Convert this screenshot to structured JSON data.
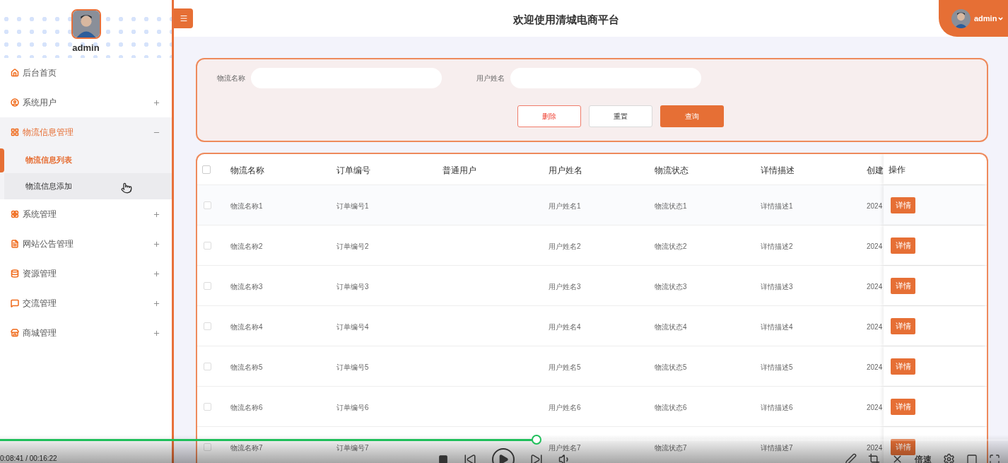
{
  "sidebar": {
    "user": {
      "name": "admin"
    },
    "menu": [
      {
        "label": "后台首页"
      },
      {
        "label": "系统用户",
        "expanded": false
      },
      {
        "label": "物流信息管理",
        "expanded": true,
        "children": [
          {
            "label": "物流信息列表",
            "selected": true,
            "hovered": false
          },
          {
            "label": "物流信息添加",
            "selected": false,
            "hovered": true
          }
        ]
      },
      {
        "label": "系统管理",
        "expanded": false
      },
      {
        "label": "网站公告管理",
        "expanded": false
      },
      {
        "label": "资源管理",
        "expanded": false
      },
      {
        "label": "交流管理",
        "expanded": false
      },
      {
        "label": "商城管理",
        "expanded": false
      }
    ]
  },
  "header": {
    "title": "欢迎使用清城电商平台",
    "user": "admin"
  },
  "search": {
    "fields": [
      {
        "label": "物流名称"
      },
      {
        "label": "用户姓名"
      }
    ],
    "buttons": [
      {
        "label": "删除",
        "kind": "danger"
      },
      {
        "label": "重置",
        "kind": "plain"
      },
      {
        "label": "查询",
        "kind": "primary"
      }
    ]
  },
  "table": {
    "all_selected": false,
    "columns": [
      "物流名称",
      "订单编号",
      "普通用户",
      "用户姓名",
      "物流状态",
      "详情描述",
      "创建",
      "操作"
    ],
    "rows": [
      {
        "selected": false,
        "cells": [
          "物流名称1",
          "订单编号1",
          "",
          "用户姓名1",
          "物流状态1",
          "详情描述1",
          "2024"
        ],
        "action": "详情"
      },
      {
        "selected": false,
        "cells": [
          "物流名称2",
          "订单编号2",
          "",
          "用户姓名2",
          "物流状态2",
          "详情描述2",
          "2024"
        ],
        "action": "详情"
      },
      {
        "selected": false,
        "cells": [
          "物流名称3",
          "订单编号3",
          "",
          "用户姓名3",
          "物流状态3",
          "详情描述3",
          "2024"
        ],
        "action": "详情"
      },
      {
        "selected": false,
        "cells": [
          "物流名称4",
          "订单编号4",
          "",
          "用户姓名4",
          "物流状态4",
          "详情描述4",
          "2024"
        ],
        "action": "详情"
      },
      {
        "selected": false,
        "cells": [
          "物流名称5",
          "订单编号5",
          "",
          "用户姓名5",
          "物流状态5",
          "详情描述5",
          "2024"
        ],
        "action": "详情"
      },
      {
        "selected": false,
        "cells": [
          "物流名称6",
          "订单编号6",
          "",
          "用户姓名6",
          "物流状态6",
          "详情描述6",
          "2024"
        ],
        "action": "详情"
      },
      {
        "selected": false,
        "cells": [
          "物流名称7",
          "订单编号7",
          "",
          "用户姓名7",
          "物流状态7",
          "详情描述7",
          "2024"
        ],
        "action": "详情"
      }
    ]
  },
  "player": {
    "time": "0:08:41 / 00:16:22",
    "level": 0.532,
    "speed": "倍速"
  }
}
